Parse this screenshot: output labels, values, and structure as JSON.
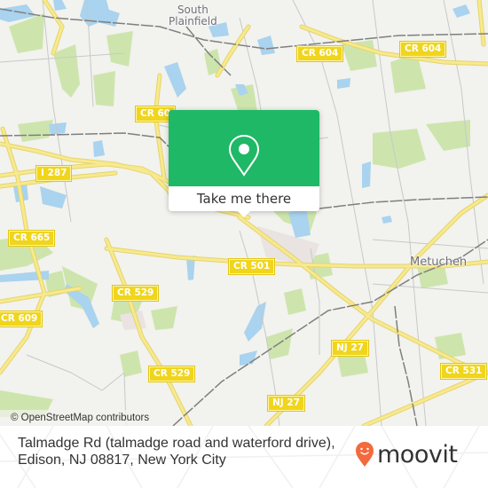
{
  "map": {
    "place_labels": [
      {
        "id": "south-plainfield",
        "text": "South\nPlainfield"
      },
      {
        "id": "metuchen",
        "text": "Metuchen"
      }
    ],
    "route_shields": [
      {
        "id": "cr604-a",
        "text": "CR 604"
      },
      {
        "id": "cr604-b",
        "text": "CR 604"
      },
      {
        "id": "cr60x",
        "text": "CR 60"
      },
      {
        "id": "i287",
        "text": "I 287"
      },
      {
        "id": "cr665",
        "text": "CR 665"
      },
      {
        "id": "cr501",
        "text": "CR 501"
      },
      {
        "id": "cr529-a",
        "text": "CR 529"
      },
      {
        "id": "cr609",
        "text": "CR 609"
      },
      {
        "id": "cr529-b",
        "text": "CR 529"
      },
      {
        "id": "nj27-a",
        "text": "NJ 27"
      },
      {
        "id": "nj27-b",
        "text": "NJ 27"
      },
      {
        "id": "cr531",
        "text": "CR 531"
      }
    ],
    "attribution": "© OpenStreetMap contributors",
    "colors": {
      "land": "#f2f2ee",
      "park": "#c8e3a8",
      "water": "#a9d3ee",
      "major_road": "#f5e57a",
      "minor_road": "#c9c9c9",
      "rail": "#808080"
    }
  },
  "popup": {
    "icon": "location-pin-icon",
    "button_label": "Take me there",
    "accent": "#1fb866"
  },
  "footer": {
    "address_line1": "Talmadge Rd (talmadge road and waterford drive),",
    "address_line2": "Edison, NJ 08817, New York City",
    "brand": "moovit",
    "brand_color": "#f26a3d"
  }
}
